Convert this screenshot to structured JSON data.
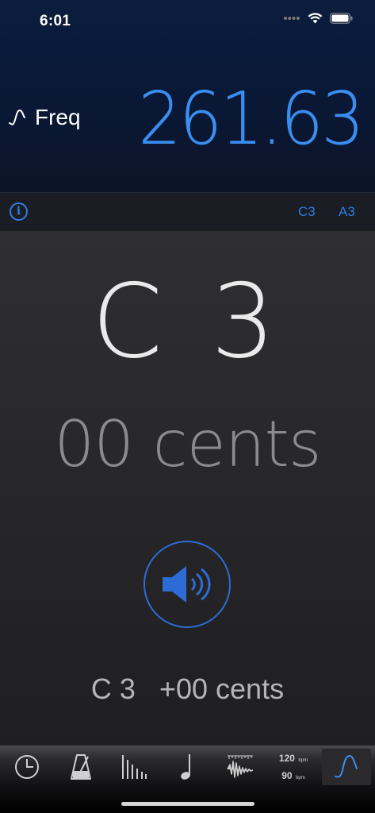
{
  "status_bar": {
    "time": "6:01"
  },
  "header": {
    "mode_label": "Freq",
    "frequency": "261.63"
  },
  "info_bar": {
    "note_button": "C3",
    "ref_button": "A3"
  },
  "main": {
    "note": "C 3",
    "cents": "00 cents",
    "ref_note": "C 3",
    "ref_cents": "+00 cents"
  },
  "tab_bar": {
    "active_tab": "tone-generator",
    "bpm_top": "120",
    "bpm_bottom": "90",
    "bpm_unit": "bpm"
  },
  "colors": {
    "accent": "#3a8ef0",
    "button_blue": "#2d6bd6"
  }
}
